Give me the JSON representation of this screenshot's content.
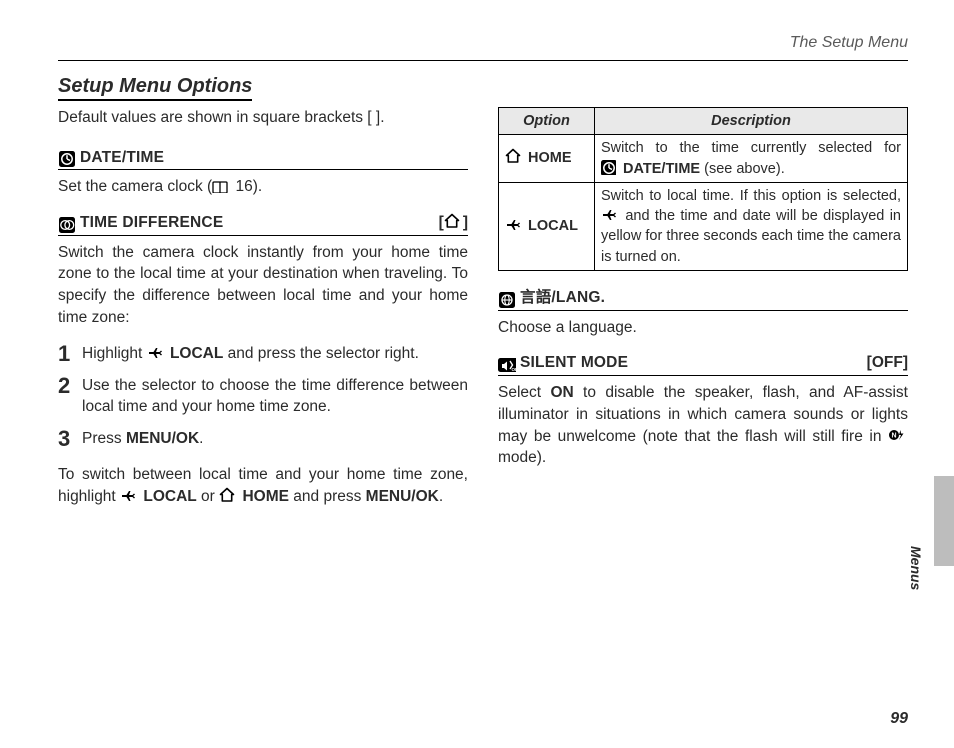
{
  "running_head": "The Setup Menu",
  "section_title": "Setup Menu Options",
  "intro": "Default values are shown in square brackets [ ].",
  "left": {
    "date_time": {
      "label": "DATE/TIME",
      "body_a": "Set the camera clock (",
      "body_b": " 16)."
    },
    "time_diff": {
      "label": "TIME DIFFERENCE",
      "default_open": "[",
      "default_close": "]",
      "para": "Switch the camera clock instantly from your home time zone to the local time at your destination when traveling.  To specify the difference between local time and your home time zone:",
      "step1_a": "Highlight ",
      "step1_local": "LOCAL",
      "step1_b": " and press the selector right.",
      "step2": "Use the selector to choose the time difference between local time and your home time zone.",
      "step3_a": "Press ",
      "step3_b": "MENU/OK",
      "step3_c": ".",
      "foot_a": "To switch between local time and your home time zone, highlight ",
      "foot_local": "LOCAL",
      "foot_mid": " or ",
      "foot_home": "HOME",
      "foot_b": " and press ",
      "foot_menu": "MENU/OK",
      "foot_c": "."
    }
  },
  "right": {
    "table": {
      "h_option": "Option",
      "h_desc": "Description",
      "home_label": "HOME",
      "home_desc_a": "Switch to the time currently selected for ",
      "home_desc_opt": "DATE/TIME",
      "home_desc_b": " (see above).",
      "local_label": "LOCAL",
      "local_desc_a": "Switch to local time.  If this option is selected, ",
      "local_desc_b": " and the time and date will be displayed in yellow for three seconds each time the camera is turned on."
    },
    "lang": {
      "label": "言語/LANG.",
      "body": "Choose a language."
    },
    "silent": {
      "label": "SILENT MODE",
      "default": "[OFF]",
      "body_a": "Select ",
      "body_on": "ON",
      "body_b": " to disable the speaker, flash, and AF-assist illuminator in situations in which camera sounds or lights may be unwelcome (note that the flash will still fire in ",
      "body_c": " mode)."
    }
  },
  "side_label": "Menus",
  "page_number": "99",
  "steps": {
    "n1": "1",
    "n2": "2",
    "n3": "3"
  }
}
